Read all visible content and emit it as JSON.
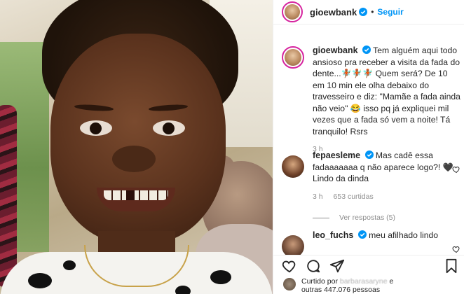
{
  "post": {
    "author": "gioewbank",
    "follow_label": "Seguir",
    "dot": "•",
    "caption": "Tem alguém aqui todo ansioso pra receber a visita da fada do dente...🧚🏾🧚🏾🧚🏾 Quem será? De 10 em 10 min ele olha debaixo do travesseiro e diz: \"Mamãe a fada ainda não veio\" 😂 isso pq já expliquei mil vezes que a fada só vem a noite! Tá tranquilo! Rsrs",
    "caption_time": "3 h"
  },
  "comments": [
    {
      "user": "fepaesleme",
      "text": "Mas cadê essa fadaaaaaaa q não aparece logo?! 🖤Lindo da dinda",
      "time": "3 h",
      "likes": "653 curtidas",
      "view_replies": "Ver respostas (5)"
    },
    {
      "user": "leo_fuchs",
      "text": "meu afilhado lindo"
    }
  ],
  "likes_bar": {
    "prefix": "Curtido por",
    "name": "barbarasaryne",
    "mid": "e",
    "suffix": "outras 447.076 pessoas"
  },
  "colors": {
    "accent": "#0095f6",
    "text": "#262626",
    "muted": "#8e8e8e",
    "story_ring": "#d6249f"
  },
  "icons": [
    "verified-icon",
    "heart-icon",
    "comment-icon",
    "share-icon",
    "bookmark-icon"
  ]
}
